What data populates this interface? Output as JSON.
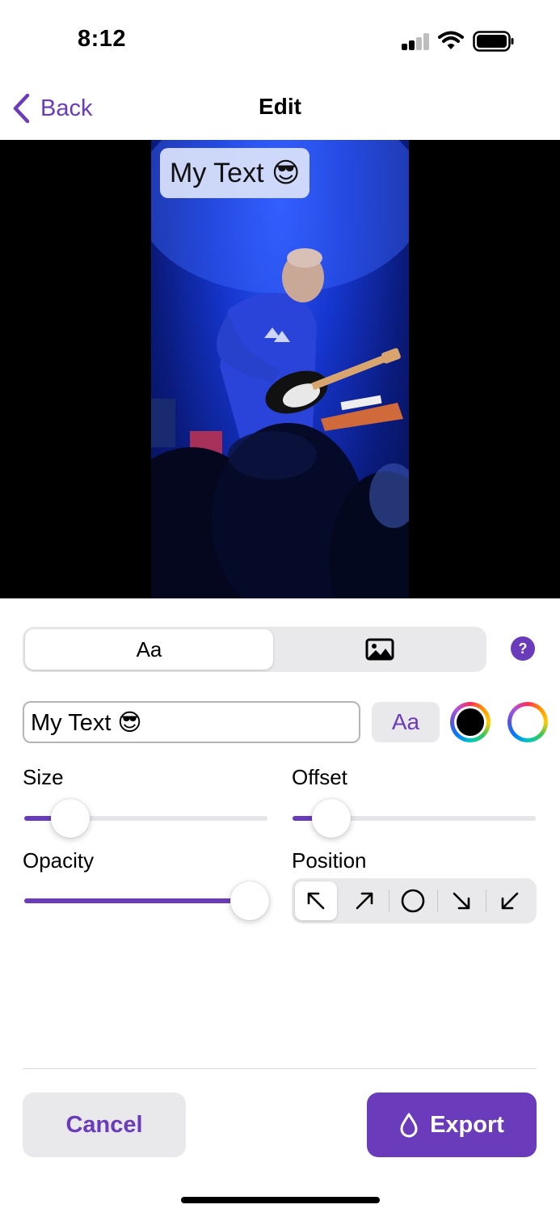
{
  "status_bar": {
    "time": "8:12",
    "signal_icon": "cellular-signal-icon",
    "wifi_icon": "wifi-icon",
    "battery_icon": "battery-icon"
  },
  "nav": {
    "back_label": "Back",
    "title": "Edit",
    "back_icon": "chevron-left-icon"
  },
  "preview": {
    "overlay_text": "My Text 😎",
    "photo_subject": "concert-guitarist-photo"
  },
  "mode_tabs": [
    {
      "label": "Aa",
      "selected": true
    },
    {
      "icon": "photo-icon",
      "selected": false
    }
  ],
  "help_button": {
    "label": "?"
  },
  "text_row": {
    "value": "My Text 😎",
    "font_button_label": "Aa",
    "text_color": "#000000",
    "background_color": "#ffffff"
  },
  "controls": {
    "size": {
      "label": "Size",
      "value": 0.19
    },
    "offset": {
      "label": "Offset",
      "value": 0.16
    },
    "opacity": {
      "label": "Opacity",
      "value": 0.93
    },
    "position": {
      "label": "Position",
      "options": [
        "top-left",
        "top-right",
        "center",
        "bottom-right",
        "bottom-left"
      ],
      "selected": "top-left"
    }
  },
  "actions": {
    "cancel": "Cancel",
    "export": "Export",
    "export_icon": "drop-icon"
  },
  "colors": {
    "accent": "#6a3cbc",
    "slider_track": "#e5e5ea",
    "segment_bg": "#e9e9eb"
  }
}
